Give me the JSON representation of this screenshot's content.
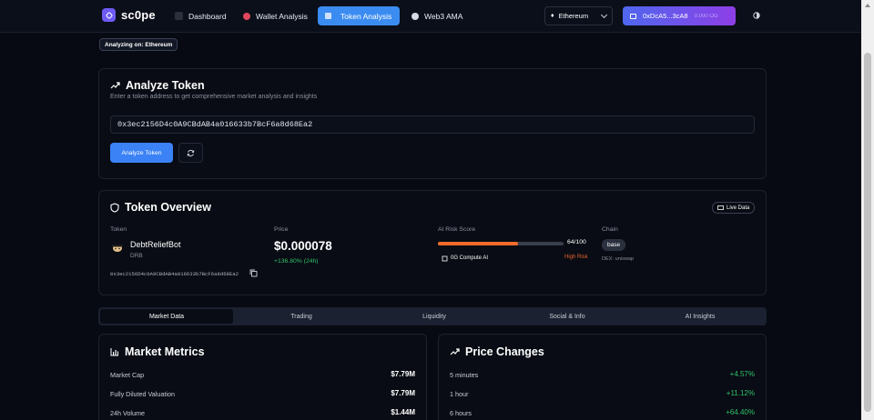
{
  "brand": {
    "name": "sc0pe"
  },
  "nav": [
    {
      "label": "Dashboard",
      "active": false
    },
    {
      "label": "Wallet Analysis",
      "active": false
    },
    {
      "label": "Token Analysis",
      "active": true
    },
    {
      "label": "Web3 AMA",
      "active": false
    }
  ],
  "chain_selector": {
    "value": "Ethereum"
  },
  "wallet": {
    "address": "0xDcA5...3cA8",
    "balance": "0.000 OG"
  },
  "analyzing_chip": "Analyzing on: Ethereum",
  "analyze": {
    "title": "Analyze Token",
    "subtitle": "Enter a token address to get comprehensive market analysis and insights",
    "input_value": "0x3ec2156D4c0A9CBdAB4a016633b7BcF6a8d68Ea2",
    "button": "Analyze Token"
  },
  "overview": {
    "title": "Token Overview",
    "live_badge": "Live Data",
    "labels": {
      "token": "Token",
      "price": "Price",
      "risk": "AI Risk Score",
      "chain": "Chain"
    },
    "token_name": "DebtReliefBot",
    "token_symbol": "DRB",
    "token_address": "0x3ec2156D4c0A9CBdAB4a016633b7BcF6a8d68Ea2",
    "price": "$0.000078",
    "price_change": "+136.80% (24h)",
    "risk_score": "64/100",
    "risk_fraction": 0.64,
    "risk_engine": "0G Compute AI",
    "risk_level": "High Risk",
    "chain": "base",
    "chain_sub": "DEX: uniswap"
  },
  "tabs": [
    "Market Data",
    "Trading",
    "Liquidity",
    "Social & Info",
    "AI Insights"
  ],
  "market_metrics": {
    "title": "Market Metrics",
    "rows": [
      {
        "label": "Market Cap",
        "value": "$7.79M"
      },
      {
        "label": "Fully Diluted Valuation",
        "value": "$7.79M"
      },
      {
        "label": "24h Volume",
        "value": "$1.44M"
      }
    ]
  },
  "price_changes": {
    "title": "Price Changes",
    "rows": [
      {
        "label": "5 minutes",
        "value": "+4.57%"
      },
      {
        "label": "1 hour",
        "value": "+11.12%"
      },
      {
        "label": "6 hours",
        "value": "+64.40%"
      }
    ]
  },
  "colors": {
    "accent": "#3b82f6",
    "positive": "#2fc16a",
    "risk": "#f26b2a",
    "wallet_from": "#4f67ee",
    "wallet_to": "#8d3fe6"
  }
}
